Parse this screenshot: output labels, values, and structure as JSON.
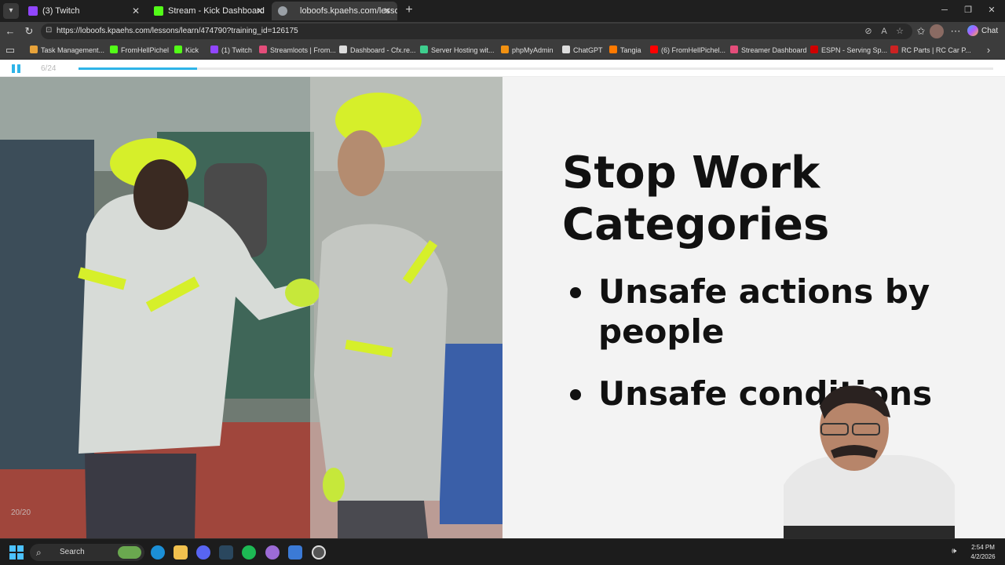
{
  "browser": {
    "tabs": [
      {
        "label": "(3) Twitch",
        "favicon": "twitch-icon",
        "color": "#9146ff",
        "active": false
      },
      {
        "label": "Stream - Kick Dashboard",
        "favicon": "kick-icon",
        "color": "#53fc18",
        "active": false
      },
      {
        "label": "loboofs.kpaehs.com/lessons/l",
        "favicon": "globe-icon",
        "color": "#9aa0a6",
        "active": true
      }
    ],
    "address": "https://loboofs.kpaehs.com/lessons/learn/474790?training_id=126175",
    "copilot_label": "Chat",
    "bookmarks": [
      {
        "label": "Task Management...",
        "color": "#e8a33a"
      },
      {
        "label": "FromHellPichel",
        "color": "#53fc18"
      },
      {
        "label": "Kick",
        "color": "#53fc18"
      },
      {
        "label": "(1) Twitch",
        "color": "#9146ff"
      },
      {
        "label": "Streamloots | From...",
        "color": "#e44d7a"
      },
      {
        "label": "Dashboard - Cfx.re...",
        "color": "#dddddd"
      },
      {
        "label": "Server Hosting wit...",
        "color": "#3ecf8e"
      },
      {
        "label": "phpMyAdmin",
        "color": "#f29111"
      },
      {
        "label": "ChatGPT",
        "color": "#dddddd"
      },
      {
        "label": "Tangia",
        "color": "#ff7a00"
      },
      {
        "label": "(6) FromHellPichel...",
        "color": "#ff0000"
      },
      {
        "label": "Streamer Dashboard",
        "color": "#e44d7a"
      },
      {
        "label": "ESPN - Serving Sp...",
        "color": "#d00000"
      },
      {
        "label": "RC Parts | RC Car P...",
        "color": "#cc2222"
      }
    ]
  },
  "player": {
    "slide_counter": "6/24",
    "progress": 0.13
  },
  "slide": {
    "title": "Stop Work Categories",
    "bullets": [
      "Unsafe actions by people",
      "Unsafe conditions"
    ],
    "photo_counter": "20/20"
  },
  "taskbar": {
    "search_label": "Search",
    "time": "2:54 PM",
    "date": "4/2/2026"
  }
}
